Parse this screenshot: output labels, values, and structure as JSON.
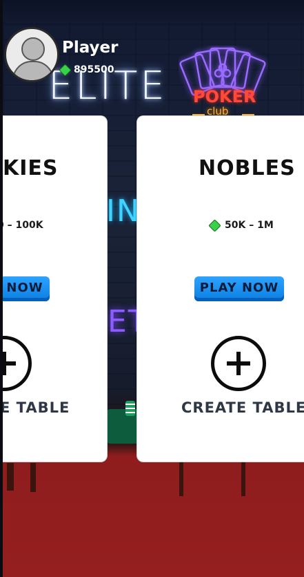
{
  "player": {
    "name": "Player",
    "coins": "895500",
    "coin_icon": "green-gem-icon",
    "avatar_icon": "default-avatar-icon"
  },
  "background": {
    "neon_elite": "ELITE",
    "poker_sign": "POKER",
    "club_sign": "club",
    "neon_mid_fragment": "IN",
    "neon_low_fragment": "ET"
  },
  "tables": [
    {
      "title": "KIES",
      "range": "0 – 100K",
      "play_label": "NOW",
      "create_label": "E TABLE"
    },
    {
      "title": "NOBLES",
      "range": "50K – 1M",
      "play_label": "PLAY NOW",
      "create_label": "CREATE TABLE"
    }
  ],
  "colors": {
    "play_button": "#1a8ff0",
    "neon_elite": "#f2f6ff",
    "poker_sign": "#ff4a3a",
    "floor": "#951f1f"
  }
}
